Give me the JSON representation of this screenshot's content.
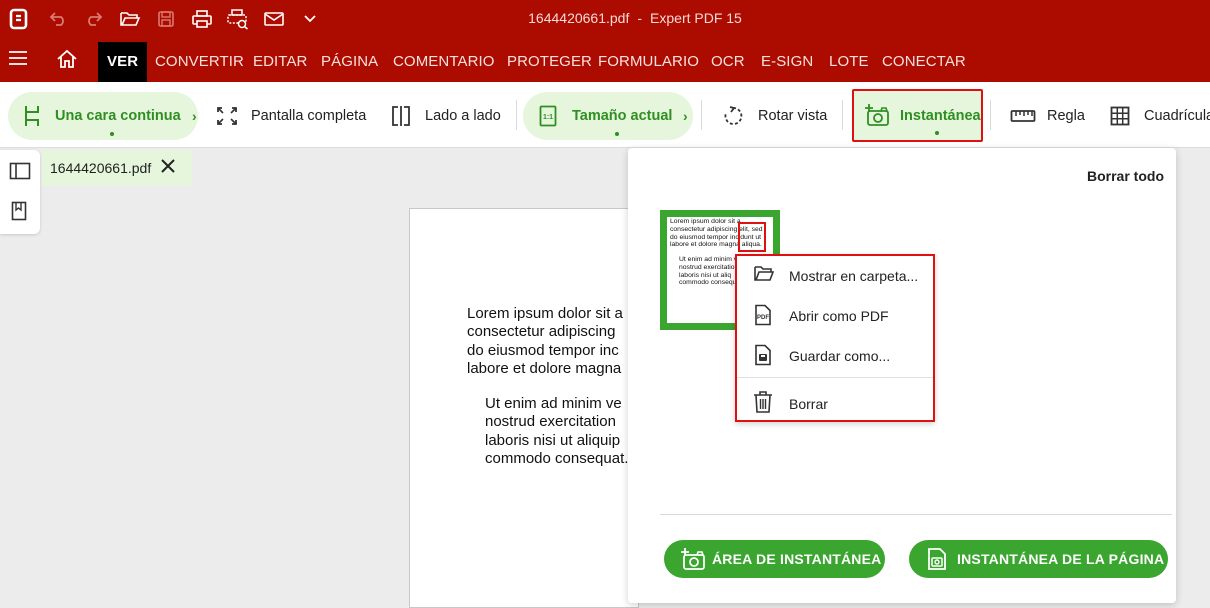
{
  "app": {
    "file_name": "1644420661.pdf",
    "separator": "-",
    "app_name": "Expert PDF 15"
  },
  "menu": {
    "tabs": [
      "VER",
      "CONVERTIR",
      "EDITAR",
      "PÁGINA",
      "COMENTARIO",
      "PROTEGER",
      "FORMULARIO",
      "OCR",
      "E-SIGN",
      "LOTE",
      "CONECTAR"
    ],
    "active": "VER"
  },
  "toolbar": {
    "una_cara": "Una cara continua",
    "pantalla": "Pantalla completa",
    "lado": "Lado a lado",
    "tamano": "Tamaño actual",
    "rotar": "Rotar vista",
    "instantanea": "Instantánea",
    "regla": "Regla",
    "cuadricula": "Cuadrícula",
    "chevron": "›"
  },
  "document_tab": {
    "label": "1644420661.pdf"
  },
  "page": {
    "para1": [
      "Lorem ipsum dolor sit a",
      "consectetur adipiscing",
      "do eiusmod tempor inc",
      "labore et dolore magna"
    ],
    "para2": [
      "Ut enim ad minim ve",
      "nostrud exercitation",
      "laboris nisi ut aliquip",
      "commodo consequat."
    ]
  },
  "snapshot_panel": {
    "clear_all": "Borrar todo",
    "thumb_para1": [
      "Lorem ipsum dolor sit a",
      "consectetur adipiscing elit, sed",
      "do eiusmod tempor incidunt ut",
      "labore et dolore magna aliqua."
    ],
    "thumb_para2": [
      "Ut enim ad minim v",
      "nostrud exercitatio",
      "laboris nisi ut aliq",
      "commodo consequat."
    ],
    "area_button": "ÁREA DE INSTANTÁNEA",
    "page_button": "INSTANTÁNEA DE LA PÁGINA"
  },
  "context_menu": {
    "show_folder": "Mostrar en carpeta...",
    "open_pdf": "Abrir como PDF",
    "save_as": "Guardar como...",
    "delete": "Borrar"
  },
  "colors": {
    "brand_red": "#ac0b00",
    "accent_green": "#3aa52f",
    "highlight_red": "#e01010",
    "pill_green_bg": "#e6f6dd"
  }
}
